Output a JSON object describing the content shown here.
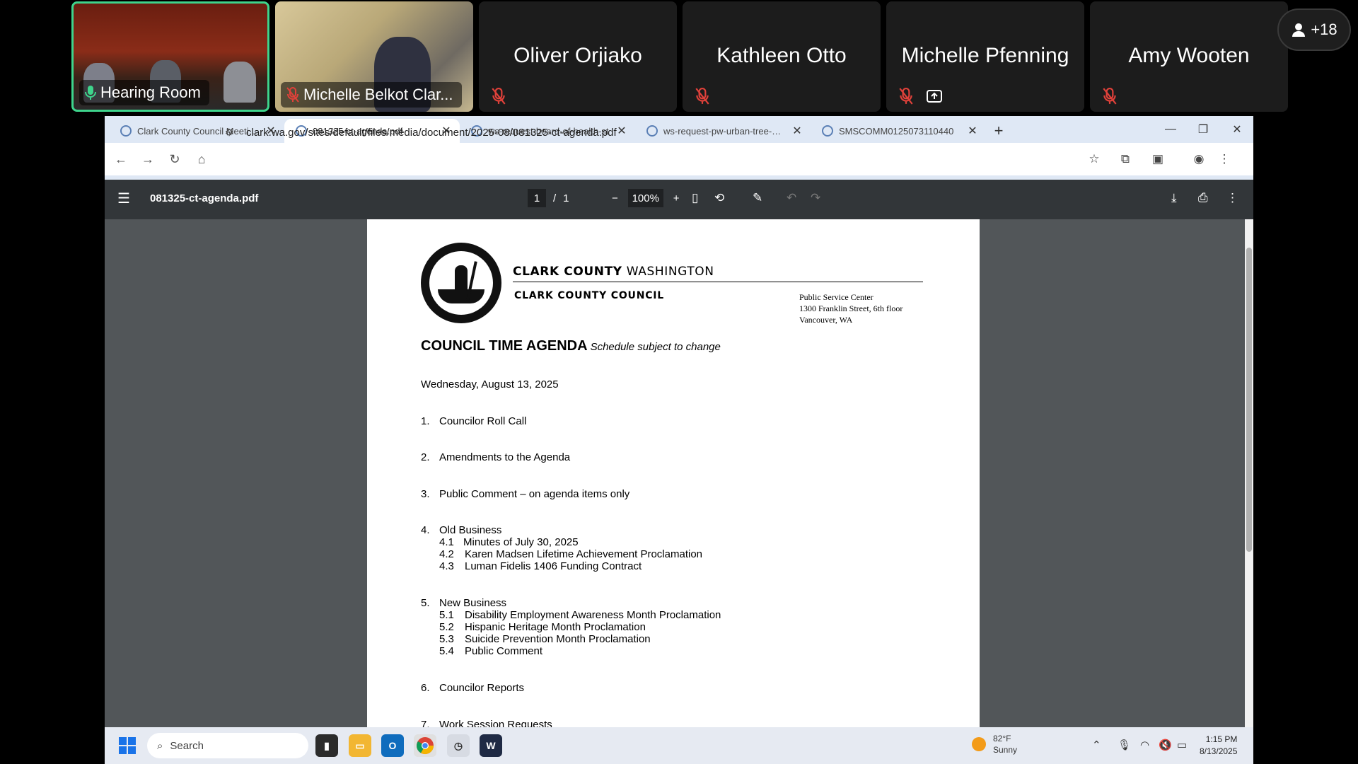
{
  "meeting": {
    "tiles": [
      {
        "name": "Hearing Room",
        "mic": "on"
      },
      {
        "name": "Michelle Belkot Clar...",
        "mic": "muted"
      },
      {
        "name": "Oliver Orjiako",
        "mic": "muted"
      },
      {
        "name": "Kathleen Otto",
        "mic": "muted"
      },
      {
        "name": "Michelle Pfenning",
        "mic": "muted"
      },
      {
        "name": "Amy Wooten",
        "mic": "muted"
      }
    ],
    "more_count": "+18"
  },
  "browser": {
    "tabs": [
      {
        "title": "Clark County Council Meetings",
        "active": false
      },
      {
        "title": "081325-ct-agenda.pdf",
        "active": true
      },
      {
        "title": "ws-request-board-of-health-st",
        "active": false
      },
      {
        "title": "ws-request-pw-urban-tree-can",
        "active": false
      },
      {
        "title": "SMSCOMM0125073110440",
        "active": false
      }
    ],
    "url": "clark.wa.gov/sites/default/files/media/document/2025-08/081325-ct-agenda.pdf"
  },
  "pdf_toolbar": {
    "filename": "081325-ct-agenda.pdf",
    "page_current": "1",
    "page_sep": "/",
    "page_total": "1",
    "zoom": "100%"
  },
  "document": {
    "county": "CLARK COUNTY",
    "state": "WASHINGTON",
    "council": "CLARK COUNTY COUNCIL",
    "address_lines": [
      "Public Service Center",
      "1300 Franklin Street, 6th floor",
      "Vancouver, WA"
    ],
    "title": "COUNCIL TIME AGENDA",
    "subtitle": "Schedule subject to change",
    "date": "Wednesday, August 13, 2025",
    "items": [
      {
        "num": "1.",
        "text": "Councilor Roll Call",
        "subs": []
      },
      {
        "num": "2.",
        "text": "Amendments to the Agenda",
        "subs": []
      },
      {
        "num": "3.",
        "text": "Public Comment – on agenda items only",
        "subs": []
      },
      {
        "num": "4.",
        "text": "Old Business",
        "subs": [
          {
            "num": "4.1",
            "text": "Minutes of July 30, 2025"
          },
          {
            "num": "4.2",
            "text": "Karen Madsen Lifetime Achievement Proclamation"
          },
          {
            "num": "4.3",
            "text": "Luman Fidelis 1406 Funding Contract"
          }
        ]
      },
      {
        "num": "5.",
        "text": "New Business",
        "subs": [
          {
            "num": "5.1",
            "text": "Disability Employment Awareness Month Proclamation"
          },
          {
            "num": "5.2",
            "text": "Hispanic Heritage Month Proclamation"
          },
          {
            "num": "5.3",
            "text": "Suicide Prevention Month Proclamation"
          },
          {
            "num": "5.4",
            "text": "Public Comment"
          }
        ]
      },
      {
        "num": "6.",
        "text": "Councilor Reports",
        "subs": []
      },
      {
        "num": "7.",
        "text": "Work Session Requests",
        "subs": []
      }
    ]
  },
  "taskbar": {
    "search_placeholder": "Search",
    "temp": "82°F",
    "condition": "Sunny",
    "time": "1:15 PM",
    "date": "8/13/2025"
  }
}
